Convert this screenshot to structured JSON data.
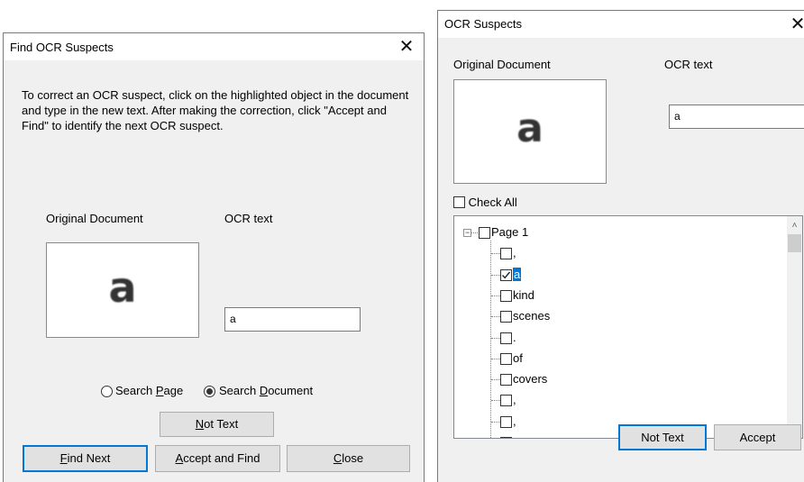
{
  "find_dialog": {
    "title": "Find OCR Suspects",
    "close_glyph": "✕",
    "description": "To correct an OCR suspect, click on the highlighted object in the document and type in the new text. After making the correction, click \"Accept and Find\" to identify the next OCR suspect.",
    "original_label": "Original Document",
    "ocr_label": "OCR text",
    "preview_glyph": "a",
    "ocr_value": "a",
    "search_page": {
      "pre": "Search ",
      "ul": "P",
      "post": "age",
      "selected": false
    },
    "search_document": {
      "pre": "Search ",
      "ul": "D",
      "post": "ocument",
      "selected": true
    },
    "not_text_button": {
      "ul": "N",
      "post": "ot Text"
    },
    "find_next_button": {
      "ul": "F",
      "post": "ind Next"
    },
    "accept_find_button": {
      "ul": "A",
      "post": "ccept and Find"
    },
    "close_button": {
      "ul": "C",
      "post": "lose"
    }
  },
  "suspects_dialog": {
    "title": "OCR Suspects",
    "close_glyph": "✕",
    "original_label": "Original Document",
    "ocr_label": "OCR text",
    "preview_glyph": "a",
    "ocr_value": "a",
    "check_all_label": "Check All",
    "tree": {
      "root_label": "Page 1",
      "items": [
        {
          "label": ",",
          "checked": false,
          "selected": false
        },
        {
          "label": "a",
          "checked": true,
          "selected": true
        },
        {
          "label": "kind",
          "checked": false,
          "selected": false
        },
        {
          "label": "scenes",
          "checked": false,
          "selected": false
        },
        {
          "label": ".",
          "checked": false,
          "selected": false
        },
        {
          "label": "of",
          "checked": false,
          "selected": false
        },
        {
          "label": "covers",
          "checked": false,
          "selected": false
        },
        {
          "label": ",",
          "checked": false,
          "selected": false
        },
        {
          "label": ",",
          "checked": false,
          "selected": false
        },
        {
          "label": ",",
          "checked": false,
          "selected": false
        }
      ]
    },
    "not_text_button": "Not Text",
    "accept_button": "Accept",
    "accent_color": "#0078d7"
  }
}
